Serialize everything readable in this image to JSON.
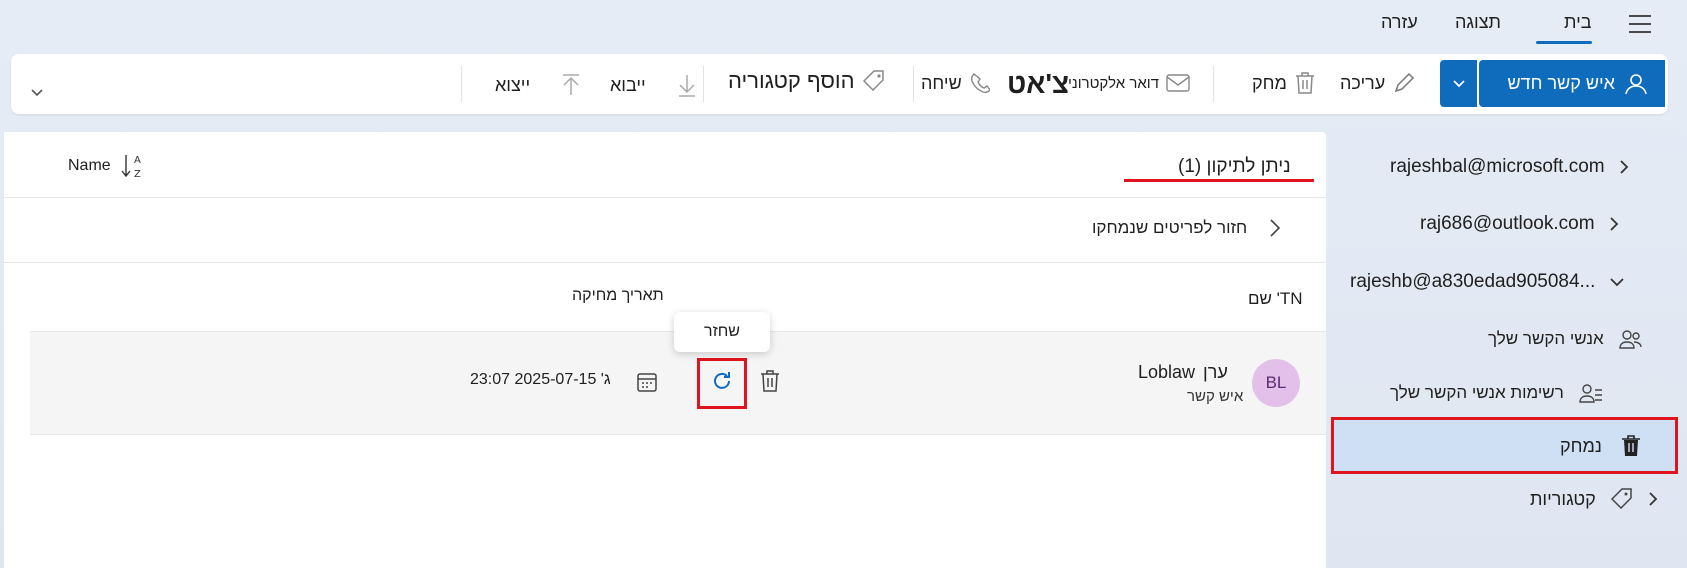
{
  "top_menu": {
    "tabs": [
      "בית",
      "תצוגה",
      "עזרה"
    ],
    "active_tab": "בית"
  },
  "ribbon": {
    "new_contact": "איש קשר חדש",
    "edit": "עריכה",
    "delete": "מחק",
    "email": "דואר אלקטרוני",
    "chat": "צ'אט",
    "call": "שיחה",
    "add_category": "הוסף קטגוריה",
    "import": "ייבוא",
    "export": "ייצוא"
  },
  "list": {
    "header_title": "ניתן לתיקון (1)",
    "sort_label": "Name",
    "back_label": "חזור לפריטים שנמחקו",
    "columns": {
      "name": "שם 'TN",
      "deleted_date": "תאריך מחיקה"
    },
    "rows": [
      {
        "initials": "BL",
        "name_first": "ערן",
        "name_last": "Loblaw",
        "type": "איש קשר",
        "deleted_date": "ג' 2025-07-15 23:07",
        "restore_tooltip": "שחזר"
      }
    ]
  },
  "sidebar": {
    "accounts": [
      "rajeshbal@microsoft.com",
      "raj686@outlook.com",
      "rajeshb@a830edad905084..."
    ],
    "items": [
      {
        "label": "אנשי הקשר שלך"
      },
      {
        "label": "רשימות אנשי הקשר שלך"
      },
      {
        "label": "נמחק"
      },
      {
        "label": "קטגוריות"
      }
    ]
  },
  "colors": {
    "accent": "#0f6cbd",
    "selection": "#cfe0f5",
    "highlight": "#e0141e"
  }
}
